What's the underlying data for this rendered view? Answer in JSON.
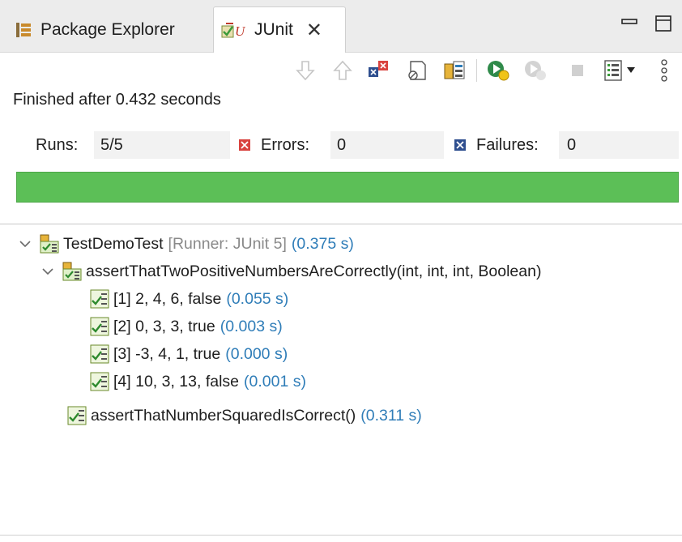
{
  "tabs": {
    "package_explorer": "Package Explorer",
    "junit": "JUnit",
    "close": "✕"
  },
  "status_text": "Finished after 0.432 seconds",
  "counters": {
    "runs_label": "Runs:",
    "runs_value": "5/5",
    "errors_label": "Errors:",
    "errors_value": "0",
    "failures_label": "Failures:",
    "failures_value": "0"
  },
  "progress": {
    "fraction": 1.0,
    "color": "#5cbf57"
  },
  "tree": {
    "root": {
      "name": "TestDemoTest",
      "runner": "[Runner: JUnit 5]",
      "time": "(0.375 s)"
    },
    "group": {
      "name": "assertThatTwoPositiveNumbersAreCorrectly(int, int, int, Boolean)"
    },
    "cases": [
      {
        "label": "[1] 2, 4, 6, false",
        "time": "(0.055 s)"
      },
      {
        "label": "[2] 0, 3, 3, true",
        "time": "(0.003 s)"
      },
      {
        "label": "[3] -3, 4, 1, true",
        "time": "(0.000 s)"
      },
      {
        "label": "[4] 10, 3, 13, false",
        "time": "(0.001 s)"
      }
    ],
    "single": {
      "name": "assertThatNumberSquaredIsCorrect()",
      "time": "(0.311 s)"
    }
  },
  "icons": {
    "toolbar": [
      "next-failure-icon",
      "previous-failure-icon",
      "show-failures-only-icon",
      "scroll-lock-icon",
      "show-skipped-icon",
      "rerun-icon",
      "rerun-failed-first-icon",
      "stop-icon",
      "history-icon",
      "view-menu-icon"
    ],
    "tree": [
      "test-suite-ok-icon",
      "test-ok-icon"
    ]
  },
  "colors": {
    "success": "#5cbf57",
    "time": "#2f7db8",
    "error": "#d9433f",
    "failure": "#2f4f8f"
  }
}
